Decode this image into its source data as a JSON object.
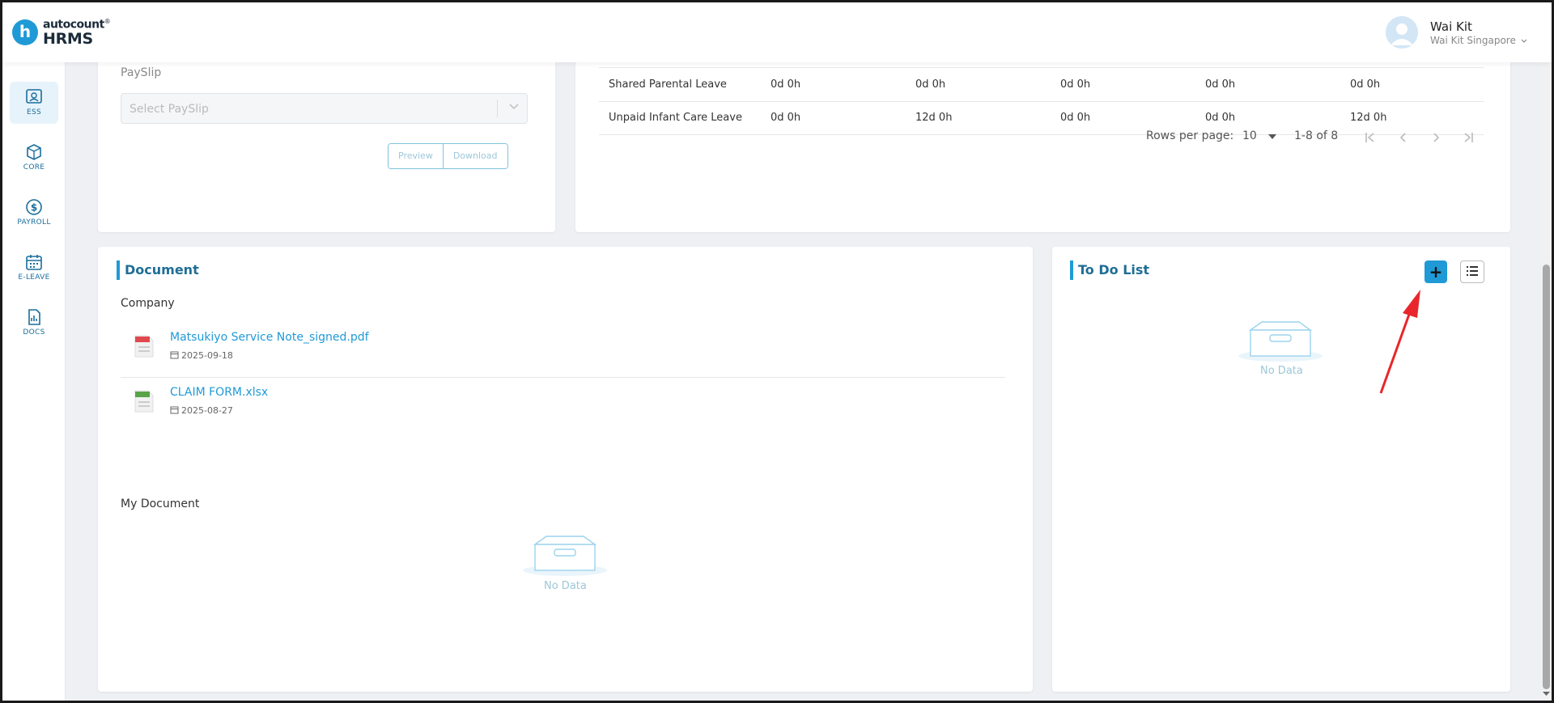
{
  "app": {
    "logo_letter": "h",
    "logo_top": "autocount",
    "logo_sup": "®",
    "logo_bottom": "HRMS"
  },
  "user": {
    "name": "Wai Kit",
    "company": "Wai Kit Singapore"
  },
  "sidebar": {
    "items": [
      {
        "label": "ESS",
        "icon": "ess-icon",
        "active": true
      },
      {
        "label": "CORE",
        "icon": "cube-icon"
      },
      {
        "label": "PAYROLL",
        "icon": "dollar-icon"
      },
      {
        "label": "E-LEAVE",
        "icon": "calendar-icon"
      },
      {
        "label": "DOCS",
        "icon": "document-chart-icon"
      }
    ]
  },
  "payslip": {
    "label": "PaySlip",
    "select_placeholder": "Select PaySlip",
    "preview_label": "Preview",
    "download_label": "Download"
  },
  "leave_table": {
    "rows": [
      [
        "Shared Parental Leave",
        "0d 0h",
        "0d 0h",
        "0d 0h",
        "0d 0h",
        "0d 0h"
      ],
      [
        "Unpaid Infant Care Leave",
        "0d 0h",
        "12d 0h",
        "0d 0h",
        "0d 0h",
        "12d 0h"
      ]
    ],
    "rows_per_page_label": "Rows per page:",
    "rows_per_page_value": "10",
    "range_label": "1-8 of 8"
  },
  "document": {
    "title": "Document",
    "company_label": "Company",
    "files": [
      {
        "name": "Matsukiyo Service Note_signed.pdf",
        "date": "2025-09-18",
        "icon": "pdf-file-icon",
        "color": "#e0484f"
      },
      {
        "name": "CLAIM FORM.xlsx",
        "date": "2025-08-27",
        "icon": "excel-file-icon",
        "color": "#5aa349"
      }
    ],
    "my_document_label": "My Document",
    "no_data": "No Data"
  },
  "todo": {
    "title": "To Do List",
    "add_label": "+",
    "no_data": "No Data"
  },
  "colors": {
    "accent": "#1f9ad6",
    "title": "#1f6e96",
    "annotation_arrow": "#e8262b"
  }
}
